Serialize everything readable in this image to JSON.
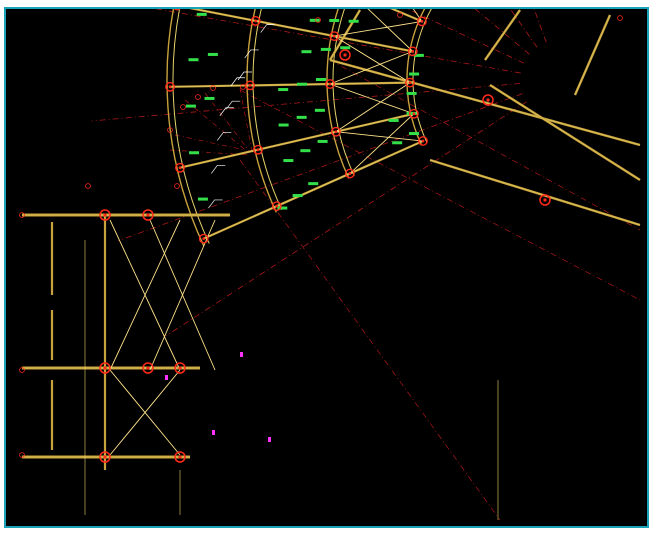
{
  "drawing": {
    "background": "#000000",
    "frame_color": "#1aa3b8",
    "palette": {
      "member": "#c8a23c",
      "member_edge": "#e6d36a",
      "node": "#ff2a1a",
      "axis": "#b01818",
      "brace": "#ffe28a",
      "dim": "#33e04a",
      "note": "#ffffff",
      "accent": "#ff33ff"
    },
    "nodes_shown": true,
    "axis_lines_shown": true,
    "labels_legible": false
  }
}
